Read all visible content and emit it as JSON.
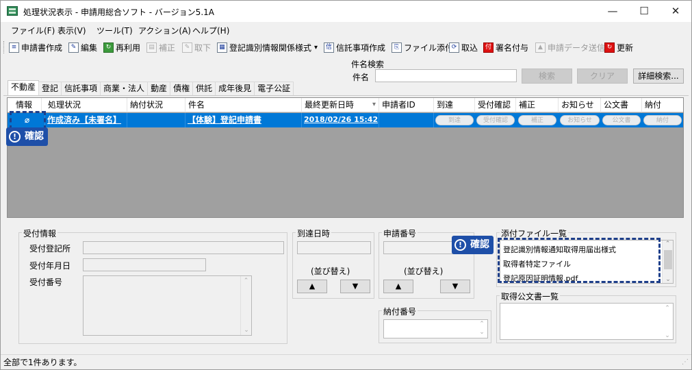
{
  "window": {
    "title": "処理状況表示 - 申請用総合ソフト - バージョン5.1A",
    "controls": {
      "minimize": "—",
      "maximize": "☐",
      "close": "✕"
    }
  },
  "menu": [
    "ファイル(F)",
    "表示(V)",
    "ツール(T)",
    "アクション(A)",
    "ヘルプ(H)"
  ],
  "toolbar": {
    "items": [
      {
        "label": "申請書作成",
        "icon": "document-create-icon",
        "enabled": true
      },
      {
        "label": "編集",
        "icon": "edit-icon",
        "enabled": true
      },
      {
        "label": "再利用",
        "icon": "reuse-icon",
        "enabled": true
      },
      {
        "label": "補正",
        "icon": "correct-icon",
        "enabled": false
      },
      {
        "label": "取下",
        "icon": "withdraw-icon",
        "enabled": false
      },
      {
        "label": "登記識別情報関係様式",
        "icon": "form-icon",
        "enabled": true,
        "dropdown": "▾"
      },
      {
        "label": "信託事項作成",
        "icon": "trust-icon",
        "enabled": true
      },
      {
        "label": "ファイル添付",
        "icon": "attach-icon",
        "enabled": true
      },
      {
        "label": "取込",
        "icon": "import-icon",
        "enabled": true
      },
      {
        "label": "署名付与",
        "icon": "sign-icon",
        "enabled": true
      },
      {
        "label": "申請データ送信",
        "icon": "send-icon",
        "enabled": false
      },
      {
        "label": "更新",
        "icon": "refresh-icon",
        "enabled": true
      }
    ]
  },
  "search": {
    "group_label": "件名検索",
    "field_label": "件名",
    "value": "",
    "search_button": "検索",
    "clear_button": "クリア",
    "detail_button": "詳細検索..."
  },
  "tabs": [
    "不動産",
    "登記",
    "信託事項",
    "商業・法人",
    "動産",
    "債権",
    "供託",
    "成年後見",
    "電子公証"
  ],
  "active_tab": 0,
  "grid": {
    "columns": [
      "情報",
      "処理状況",
      "納付状況",
      "件名",
      "最終更新日時",
      "申請者ID",
      "到達",
      "受付確認",
      "補正",
      "お知らせ",
      "公文書",
      "納付"
    ],
    "sort_indicator": "▾",
    "rows": [
      {
        "info_icon": "paperclip-icon",
        "status": "作成済み【未署名】",
        "payment_status": "",
        "subject": "【体験】登記申請書",
        "updated": "2018/02/26 15:42",
        "applicant_id": "",
        "buttons": [
          "到達",
          "受付確認",
          "補正",
          "お知らせ",
          "公文書",
          "納付"
        ]
      }
    ]
  },
  "callouts": [
    {
      "icon": "!",
      "label": "確認"
    },
    {
      "icon": "!",
      "label": "確認"
    }
  ],
  "receipt": {
    "group_label": "受付情報",
    "office_label": "受付登記所",
    "date_label": "受付年月日",
    "number_label": "受付番号",
    "office_value": "",
    "date_value": "",
    "number_value": ""
  },
  "arrival": {
    "group_label": "到達日時",
    "sort_label": "(並び替え)",
    "up": "▲",
    "down": "▼"
  },
  "application": {
    "group_label": "申請番号",
    "sort_label": "(並び替え)",
    "up": "▲",
    "down": "▼"
  },
  "payment": {
    "group_label": "納付番号"
  },
  "attachments": {
    "group_label": "添付ファイル一覧",
    "items": [
      "登記識別情報通知取得用届出様式",
      "取得者特定ファイル",
      "登記原因証明情報.pdf"
    ]
  },
  "official_docs": {
    "group_label": "取得公文書一覧",
    "items": []
  },
  "status_bar": "全部で1件あります。"
}
